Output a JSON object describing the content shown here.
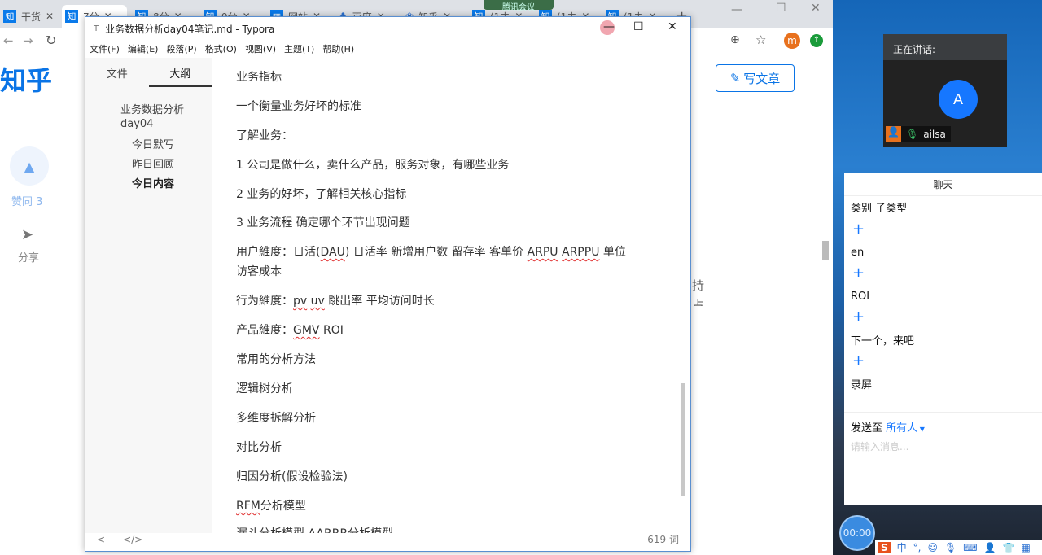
{
  "browser": {
    "tabs": [
      {
        "label": "干货"
      },
      {
        "label": "7分"
      },
      {
        "label": "8分"
      },
      {
        "label": "9分"
      },
      {
        "label": "网站"
      },
      {
        "label": "百度"
      },
      {
        "label": "知乎"
      },
      {
        "label": "(1未"
      },
      {
        "label": "(1未"
      },
      {
        "label": "(1未"
      }
    ],
    "meeting_badge": "腾讯会议",
    "logo": "知乎",
    "write_button": "写文章",
    "vote_label": "赞同 3",
    "share_label": "分享",
    "behind_text": [
      "持",
      "占"
    ],
    "avatar_letter": "m"
  },
  "typora": {
    "title": "业务数据分析day04笔记.md - Typora",
    "menu": [
      "文件(F)",
      "编辑(E)",
      "段落(P)",
      "格式(O)",
      "视图(V)",
      "主题(T)",
      "帮助(H)"
    ],
    "sidebar_tabs": [
      "文件",
      "大纲"
    ],
    "outline": [
      {
        "label": "业务数据分析day04"
      },
      {
        "label": "今日默写"
      },
      {
        "label": "昨日回顾"
      },
      {
        "label": "今日内容"
      }
    ],
    "lines": [
      "业务指标",
      "一个衡量业务好坏的标准",
      "了解业务：",
      "1 公司是做什么，卖什么产品，服务对象，有哪些业务",
      "2 业务的好坏，了解相关核心指标",
      "3 业务流程 确定哪个环节出现问题"
    ],
    "user_dim": {
      "prefix": "用户維度：日活(",
      "dau": "DAU",
      ") 日活率 新增用户数 留存率 客单价 ": ") 日活率 新增用户数 留存率 客单价 ",
      "mid": ") 日活率 新增用户数 留存率 客单价 ",
      "arpu": "ARPU",
      "arppu": "ARPPU",
      "suffix": " 单位",
      "line2": "访客成本"
    },
    "behavior_dim": {
      "prefix": "行为維度：",
      "pv": "pv",
      "uv": "uv",
      "suffix": " 跳出率 平均访问时长"
    },
    "product_dim": {
      "prefix": "产品維度：",
      "gmv": "GMV",
      "roi": " ROI"
    },
    "lines2": [
      "常用的分析方法",
      "逻辑树分析",
      "多维度拆解分析",
      "对比分析",
      "归因分析(假设检验法)"
    ],
    "rfm": {
      "a": "RFM",
      "b": "分析模型"
    },
    "partial_line": "漏斗分析模型 AARRR分析模型",
    "word_count": "619 词"
  },
  "meeting": {
    "speaking_label": "正在讲话:",
    "avatar_letter": "A",
    "speaker_name": "ailsa",
    "chat_title": "聊天",
    "messages": [
      "类别 子类型",
      "en",
      "ROI",
      "下一个，来吧",
      "录屏"
    ],
    "send_to_label": "发送至",
    "send_to_target": "所有人",
    "input_placeholder": "请输入消息...",
    "timer": "00:00"
  },
  "ime": {
    "label": "中",
    "punct": "°,"
  }
}
